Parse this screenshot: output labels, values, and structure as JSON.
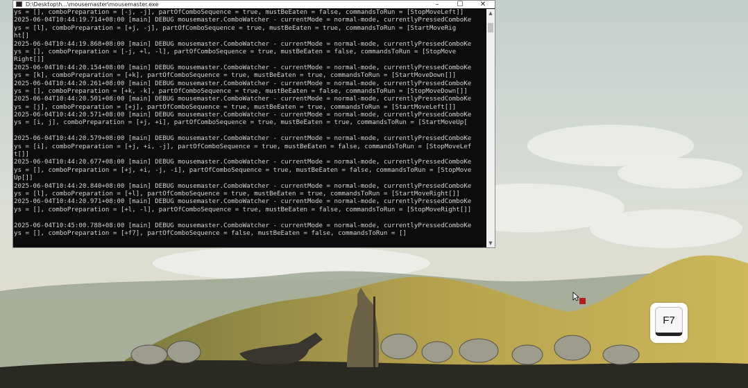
{
  "window": {
    "title": "D:\\Desktop\\h...\\mousemaster\\mousemaster.exe",
    "minimize_glyph": "–",
    "maximize_glyph": "☐",
    "close_glyph": "✕"
  },
  "console": {
    "lines": [
      "ys = [], comboPreparation = [-j, -j], partOfComboSequence = true, mustBeEaten = false, commandsToRun = [StopMoveLeft]]",
      "2025-06-04T10:44:19.714+08:00 [main] DEBUG mousemaster.ComboWatcher - currentMode = normal-mode, currentlyPressedComboKe",
      "ys = [l], comboPreparation = [+j, -j], partOfComboSequence = true, mustBeEaten = true, commandsToRun = [StartMoveRig",
      "ht[]",
      "2025-06-04T10:44:19.868+08:00 [main] DEBUG mousemaster.ComboWatcher - currentMode = normal-mode, currentlyPressedComboKe",
      "ys = [], comboPreparation = [-j, +l, -l], partOfComboSequence = true, mustBeEaten = false, commandsToRun = [StopMove",
      "Right[]]",
      "2025-06-04T10:44:20.154+08:00 [main] DEBUG mousemaster.ComboWatcher - currentMode = normal-mode, currentlyPressedComboKe",
      "ys = [k], comboPreparation = [+k], partOfComboSequence = true, mustBeEaten = true, commandsToRun = [StartMoveDown[]]",
      "2025-06-04T10:44:20.261+08:00 [main] DEBUG mousemaster.ComboWatcher - currentMode = normal-mode, currentlyPressedComboKe",
      "ys = [], comboPreparation = [+k, -k], partOfComboSequence = true, mustBeEaten = false, commandsToRun = [StopMoveDown[]]",
      "2025-06-04T10:44:20.501+08:00 [main] DEBUG mousemaster.ComboWatcher - currentMode = normal-mode, currentlyPressedComboKe",
      "ys = [j], comboPreparation = [+j], partOfComboSequence = true, mustBeEaten = true, commandsToRun = [StartMoveLeft[]]",
      "2025-06-04T10:44:20.571+08:00 [main] DEBUG mousemaster.ComboWatcher - currentMode = normal-mode, currentlyPressedComboKe",
      "ys = [i, j], comboPreparation = [+j, +i], partOfComboSequence = true, mustBeEaten = true, commandsToRun = [StartMoveUp[",
      "",
      "2025-06-04T10:44:20.579+08:00 [main] DEBUG mousemaster.ComboWatcher - currentMode = normal-mode, currentlyPressedComboKe",
      "ys = [i], comboPreparation = [+j, +i, -j], partOfComboSequence = true, mustBeEaten = false, commandsToRun = [StopMoveLef",
      "t[]]",
      "2025-06-04T10:44:20.677+08:00 [main] DEBUG mousemaster.ComboWatcher - currentMode = normal-mode, currentlyPressedComboKe",
      "ys = [], comboPreparation = [+j, +i, -j, -i], partOfComboSequence = true, mustBeEaten = false, commandsToRun = [StopMove",
      "Up[]]",
      "2025-06-04T10:44:20.840+08:00 [main] DEBUG mousemaster.ComboWatcher - currentMode = normal-mode, currentlyPressedComboKe",
      "ys = [l], comboPreparation = [+l], partOfComboSequence = true, mustBeEaten = true, commandsToRun = [StartMoveRight[]]",
      "2025-06-04T10:44:20.971+08:00 [main] DEBUG mousemaster.ComboWatcher - currentMode = normal-mode, currentlyPressedComboKe",
      "ys = [], comboPreparation = [+l, -l], partOfComboSequence = true, mustBeEaten = false, commandsToRun = [StopMoveRight[]]",
      "",
      "2025-06-04T10:45:00.788+08:00 [main] DEBUG mousemaster.ComboWatcher - currentMode = normal-mode, currentlyPressedComboKe",
      "ys = [], comboPreparation = [+f7], partOfComboSequence = false, mustBeEaten = false, commandsToRun = []"
    ]
  },
  "scrollbar": {
    "up_glyph": "▲",
    "down_glyph": "▼"
  },
  "key_indicator": {
    "label": "F7"
  },
  "colors": {
    "console_background": "#0c0c0c",
    "console_text": "#d4d4d4",
    "cursor_marker": "#b31d1d",
    "sky": "#c9d4cf",
    "hills": "#a89a4a"
  }
}
